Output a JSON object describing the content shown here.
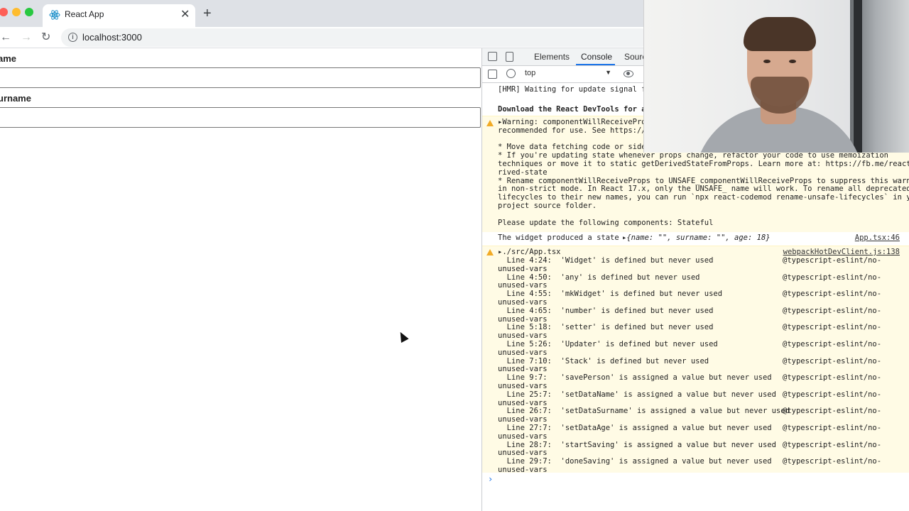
{
  "browser": {
    "tab_title": "React App",
    "tab_close": "✕",
    "new_tab": "+",
    "url": "localhost:3000"
  },
  "page": {
    "fields": [
      {
        "label": "Name",
        "visible_label": "ame",
        "value": ""
      },
      {
        "label": "Surname",
        "visible_label": "urname",
        "value": ""
      }
    ]
  },
  "devtools": {
    "tabs": [
      "Elements",
      "Console",
      "Sourc"
    ],
    "active_tab": "Console",
    "context": "top",
    "console": {
      "hmr": "[HMR] Waiting for update signal fr",
      "download": "Download the React DevTools for a",
      "warning_lines": [
        "▸Warning: componentWillReceiveProp",
        "recommended for use. See https://f",
        "",
        "* Move data fetching code or side",
        "* If you're updating state whenever props change, refactor your code to use memoization",
        "techniques or move it to static getDerivedStateFromProps. Learn more at: https://fb.me/react-de",
        "rived-state",
        "* Rename componentWillReceiveProps to UNSAFE_componentWillReceiveProps to suppress this warning",
        "in non-strict mode. In React 17.x, only the UNSAFE_ name will work. To rename all deprecated",
        "lifecycles to their new names, you can run `npx react-codemod rename-unsafe-lifecycles` in your",
        "project source folder.",
        "",
        "Please update the following components: Stateful"
      ],
      "log": {
        "text": "The widget produced a state",
        "object": "▸{name: \"\", surname: \"\", age: 18}",
        "source": "App.tsx:46"
      },
      "eslint": {
        "header": "▸./src/App.tsx",
        "source": "webpackHotDevClient.js:138",
        "rows": [
          {
            "text": "  Line 4:24:  'Widget' is defined but never used",
            "rule": "@typescript-eslint/no-"
          },
          {
            "text": "  Line 4:50:  'any' is defined but never used",
            "rule": "@typescript-eslint/no-"
          },
          {
            "text": "  Line 4:55:  'mkWidget' is defined but never used",
            "rule": "@typescript-eslint/no-"
          },
          {
            "text": "  Line 4:65:  'number' is defined but never used",
            "rule": "@typescript-eslint/no-"
          },
          {
            "text": "  Line 5:18:  'setter' is defined but never used",
            "rule": "@typescript-eslint/no-"
          },
          {
            "text": "  Line 5:26:  'Updater' is defined but never used",
            "rule": "@typescript-eslint/no-"
          },
          {
            "text": "  Line 7:10:  'Stack' is defined but never used",
            "rule": "@typescript-eslint/no-"
          },
          {
            "text": "  Line 9:7:   'savePerson' is assigned a value but never used",
            "rule": "@typescript-eslint/no-"
          },
          {
            "text": "  Line 25:7:  'setDataName' is assigned a value but never used",
            "rule": "@typescript-eslint/no-"
          },
          {
            "text": "  Line 26:7:  'setDataSurname' is assigned a value but never used",
            "rule": "@typescript-eslint/no-"
          },
          {
            "text": "  Line 27:7:  'setDataAge' is assigned a value but never used",
            "rule": "@typescript-eslint/no-"
          },
          {
            "text": "  Line 28:7:  'startSaving' is assigned a value but never used",
            "rule": "@typescript-eslint/no-"
          },
          {
            "text": "  Line 29:7:  'doneSaving' is assigned a value but never used",
            "rule": "@typescript-eslint/no-"
          }
        ],
        "wrap": "unused-vars"
      },
      "prompt": "›"
    }
  },
  "colors": {
    "warn_bg": "#fffbe5",
    "accent": "#1a73e8",
    "warn_icon": "#f2ab26"
  }
}
